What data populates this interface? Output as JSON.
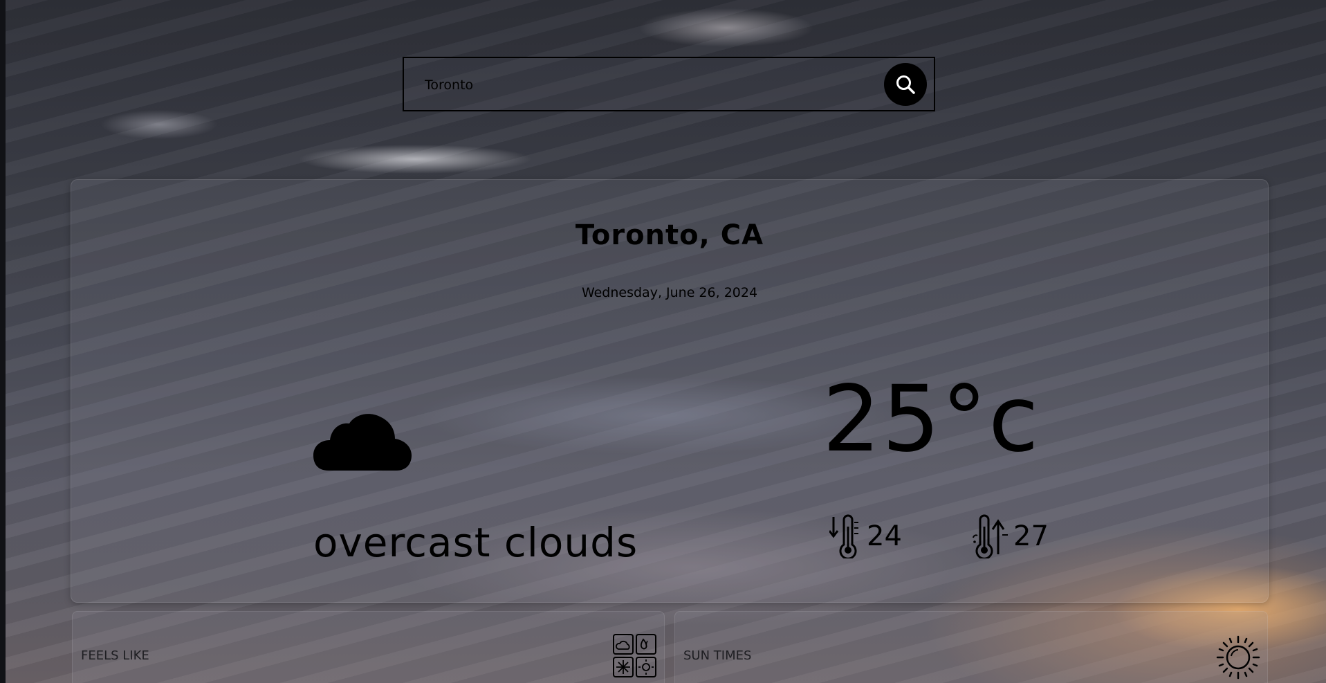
{
  "search": {
    "value": "Toronto",
    "button_icon": "search-icon"
  },
  "current": {
    "city": "Toronto, CA",
    "date": "Wednesday, June 26, 2024",
    "condition_icon": "cloud-icon",
    "description": "overcast clouds",
    "temperature": "25°c",
    "temp_min": "24",
    "temp_max": "27",
    "min_icon": "thermometer-down-icon",
    "max_icon": "thermometer-up-icon"
  },
  "cards": {
    "feels_like": {
      "title": "FEELS LIKE",
      "icon": "weather-conditions-icon"
    },
    "sun_times": {
      "title": "SUN TIMES",
      "icon": "sun-icon"
    }
  }
}
